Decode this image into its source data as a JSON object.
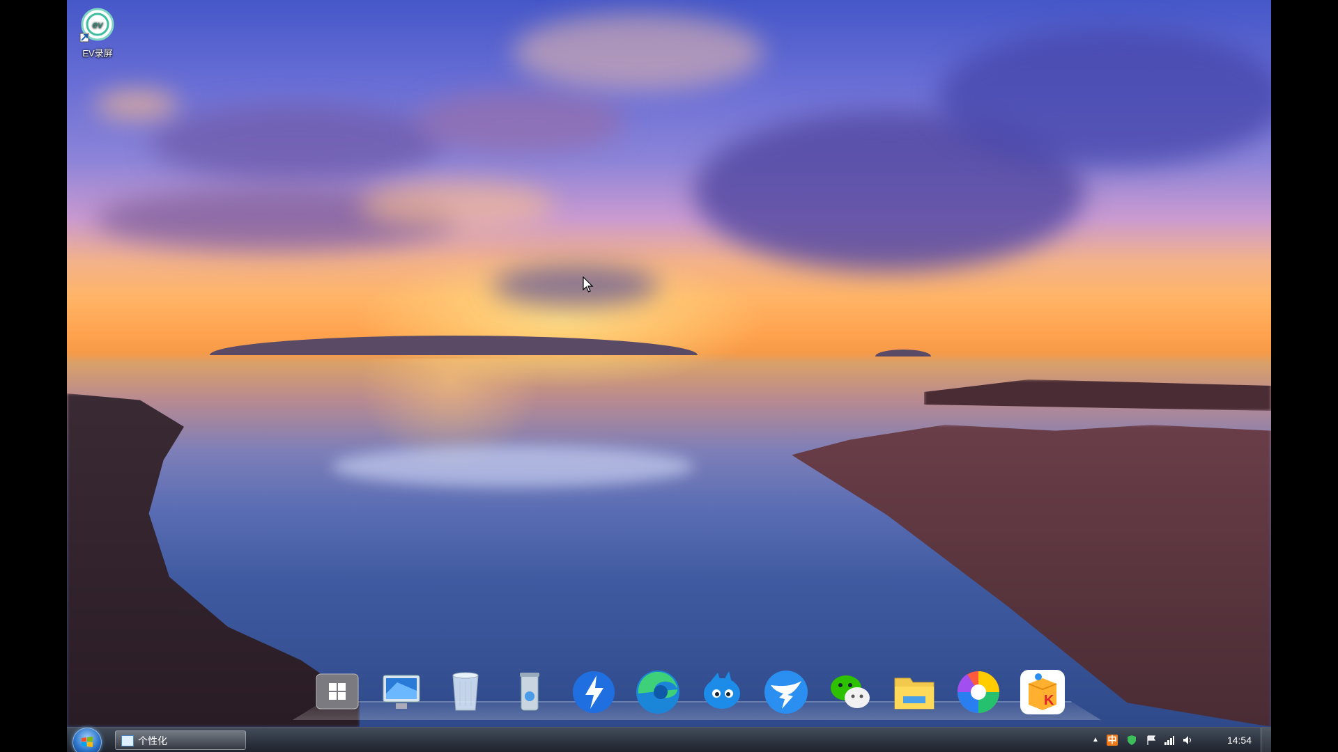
{
  "desktop": {
    "wallpaper": "sunset-seascape",
    "icons": [
      {
        "label": "EV录屏",
        "icon": "ev-recorder-icon"
      }
    ]
  },
  "dock": {
    "items": [
      {
        "name": "windows-start-icon"
      },
      {
        "name": "computer-icon"
      },
      {
        "name": "recycle-bin-icon"
      },
      {
        "name": "trash-can-icon"
      },
      {
        "name": "thunder-icon"
      },
      {
        "name": "edge-browser-icon"
      },
      {
        "name": "bird-app-icon"
      },
      {
        "name": "dingtalk-icon"
      },
      {
        "name": "wechat-icon"
      },
      {
        "name": "file-explorer-icon"
      },
      {
        "name": "color-wheel-app-icon"
      },
      {
        "name": "kuaizip-icon"
      }
    ]
  },
  "taskbar": {
    "active_window": "个性化",
    "tray": {
      "ime": "中",
      "clock": "14:54"
    },
    "colors": {
      "accent": "#2a72c8",
      "ime": "#f07a1a"
    }
  }
}
